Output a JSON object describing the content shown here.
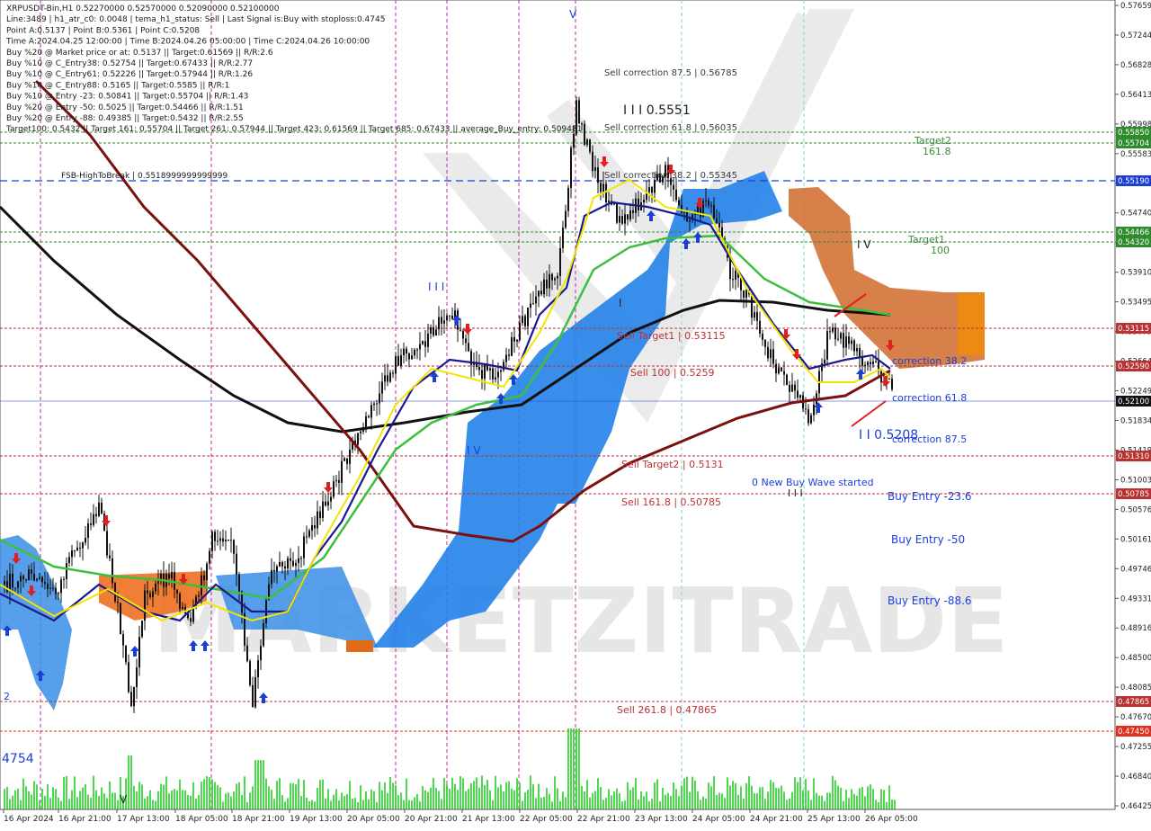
{
  "header": {
    "lines": [
      "XRPUSDT-Bin,H1  0.52270000 0.52570000 0.52090000 0.52100000",
      "Line:3489 | h1_atr_c0: 0.0048 | tema_h1_status: Sell | Last Signal is:Buy with stoploss:0.4745",
      "Point A:0.5137 | Point B:0.5361 | Point C:0.5208",
      "Time A:2024.04.25 12:00:00 | Time B:2024.04.26 05:00:00 | Time C:2024.04.26 10:00:00",
      "Buy %20 @ Market price or at: 0.5137 || Target:0.61569 || R/R:2.6",
      "Buy %10 @ C_Entry38: 0.52754 || Target:0.67433 || R/R:2.77",
      "Buy %10 @ C_Entry61: 0.52226 || Target:0.57944 || R/R:1.26",
      "Buy %10 @ C_Entry88: 0.5165 || Target:0.5585 || R/R:1",
      "Buy %10 @ Entry -23: 0.50841 || Target:0.55704 || R/R:1.43",
      "Buy %20 @ Entry -50: 0.5025 || Target:0.54466 || R/R:1.51",
      "Buy %20 @ Entry -88: 0.49385 || Target:0.5432 || R/R:2.55",
      "Target100: 0.5432 || Target 161: 0.55704 || Target 261: 0.57944 || Target 423: 0.61569 || Target 685: 0.67433 || average_Buy_entry: 0.509481"
    ]
  },
  "price_axis": {
    "ticks": [
      "0.57659",
      "0.57244",
      "0.56828",
      "0.56413",
      "0.55998",
      "0.55583",
      "0.55167",
      "0.54740",
      "0.54325",
      "0.53910",
      "0.53495",
      "0.53079",
      "0.52664",
      "0.52249",
      "0.51834",
      "0.51419",
      "0.51003",
      "0.50576",
      "0.50161",
      "0.49746",
      "0.49331",
      "0.48916",
      "0.48500",
      "0.48085",
      "0.47670",
      "0.47255",
      "0.46840",
      "0.46425"
    ],
    "badges": [
      {
        "text": "0.55850",
        "color": "#2e8b2e"
      },
      {
        "text": "0.55704",
        "color": "#2e8b2e"
      },
      {
        "text": "0.55190",
        "color": "#1a3fd6"
      },
      {
        "text": "0.54466",
        "color": "#2e8b2e"
      },
      {
        "text": "0.54320",
        "color": "#2e8b2e"
      },
      {
        "text": "0.53115",
        "color": "#b83232"
      },
      {
        "text": "0.52590",
        "color": "#b83232"
      },
      {
        "text": "0.52100",
        "color": "#111111"
      },
      {
        "text": "0.51310",
        "color": "#b83232"
      },
      {
        "text": "0.50785",
        "color": "#b83232"
      },
      {
        "text": "0.47865",
        "color": "#b83232"
      },
      {
        "text": "0.47450",
        "color": "#e0301e"
      }
    ]
  },
  "time_axis": {
    "labels": [
      "16 Apr 2024",
      "16 Apr 21:00",
      "17 Apr 13:00",
      "18 Apr 05:00",
      "18 Apr 21:00",
      "19 Apr 13:00",
      "20 Apr 05:00",
      "20 Apr 21:00",
      "21 Apr 13:00",
      "22 Apr 05:00",
      "22 Apr 21:00",
      "23 Apr 13:00",
      "24 Apr 05:00",
      "24 Apr 21:00",
      "25 Apr 13:00",
      "26 Apr 05:00"
    ]
  },
  "annotations": {
    "fsb": "FSB-HighToBreak | 0.5518999999999999",
    "sell_corr_875": "Sell correction 87.5 | 0.56785",
    "sell_corr_618": "Sell correction 61.8 | 0.56035",
    "sell_corr_382": "Sell correction 38.2 | 0.55345",
    "point_b_label": "I I I  0.5551",
    "sell_target1": "Sell Target1 | 0.53115",
    "sell_100": "Sell 100 | 0.5259",
    "sell_target2": "Sell Target2 | 0.5131",
    "sell_1618": "Sell 161.8 | 0.50785",
    "sell_2618": "Sell  261.8 | 0.47865",
    "target2": "Target2",
    "target2_val": "161.8",
    "target1": "Target1",
    "target1_val": "100",
    "corr_382": "correction 38.2",
    "corr_618": "correction 61.8",
    "corr_875": "correction 87.5",
    "point_c_label": "I I  0.5208",
    "new_wave": "0 New Buy Wave started",
    "buy_entry_236": "Buy Entry -23.6",
    "buy_entry_50": "Buy Entry -50",
    "buy_entry_886": "Buy Entry -88.6",
    "marker_iii": "I I I",
    "marker_iv": "I V",
    "marker_v": "V",
    "marker_i": "I",
    "marker_iiv": "I V",
    "left_val": "4754",
    "left_two": "2",
    "watermark": "MARKETZITRADE"
  }
}
